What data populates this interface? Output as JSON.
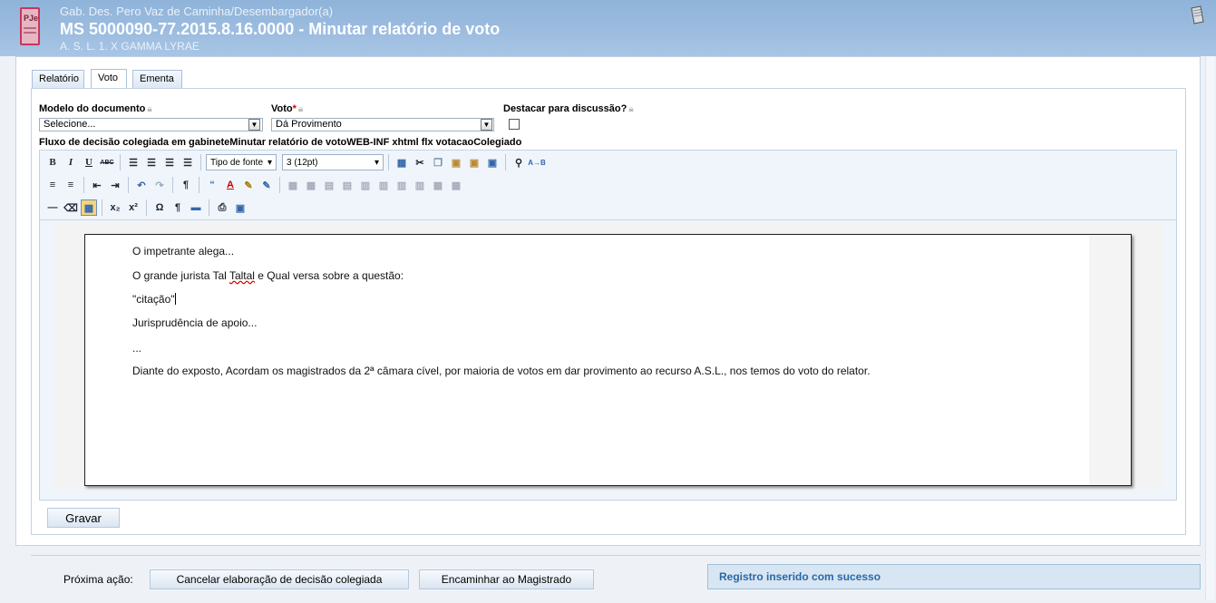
{
  "header": {
    "subtitle": "Gab. Des. Pero Vaz de Caminha/Desembargador(a)",
    "title": "MS 5000090-77.2015.8.16.0000 - Minutar relatório de voto",
    "parties": "A. S. L. 1. X GAMMA LYRAE",
    "logo_text": "PJe"
  },
  "tabs": [
    {
      "label": "Relatório",
      "active": false
    },
    {
      "label": "Voto",
      "active": true
    },
    {
      "label": "Ementa",
      "active": false
    }
  ],
  "form": {
    "model_label": "Modelo do documento",
    "model_value": "Selecione...",
    "vote_label": "Voto",
    "vote_required": "*",
    "vote_value": "Dá Provimento",
    "highlight_label": "Destacar para discussão?",
    "highlight_checked": false,
    "flow_text": "Fluxo de decisão colegiada em gabineteMinutar relatório de votoWEB-INF xhtml flx votacaoColegiado"
  },
  "toolbar": {
    "font_family": "Tipo de fonte",
    "font_size": "3 (12pt)"
  },
  "document": {
    "paragraphs": [
      "O impetrante alega...",
      "O grande jurista Tal ",
      "\"citação\"",
      "Jurisprudência de apoio...",
      "...",
      "Diante do exposto, Acordam os magistrados da 2ª câmara cível, por maioria de votos em dar provimento ao recurso A.S.L., nos temos do voto do relator."
    ],
    "p2_misspelled": "Taltal",
    "p2_rest": " e Qual versa sobre a questão:"
  },
  "actions": {
    "save_label": "Gravar",
    "next_label": "Próxima ação:",
    "cancel_label": "Cancelar elaboração de decisão colegiada",
    "forward_label": "Encaminhar ao Magistrado"
  },
  "status": {
    "message": "Registro inserido com sucesso"
  },
  "colors": {
    "header": "#9dbde0",
    "message_bg": "#d7e6f2",
    "message_text": "#2a67a8"
  }
}
